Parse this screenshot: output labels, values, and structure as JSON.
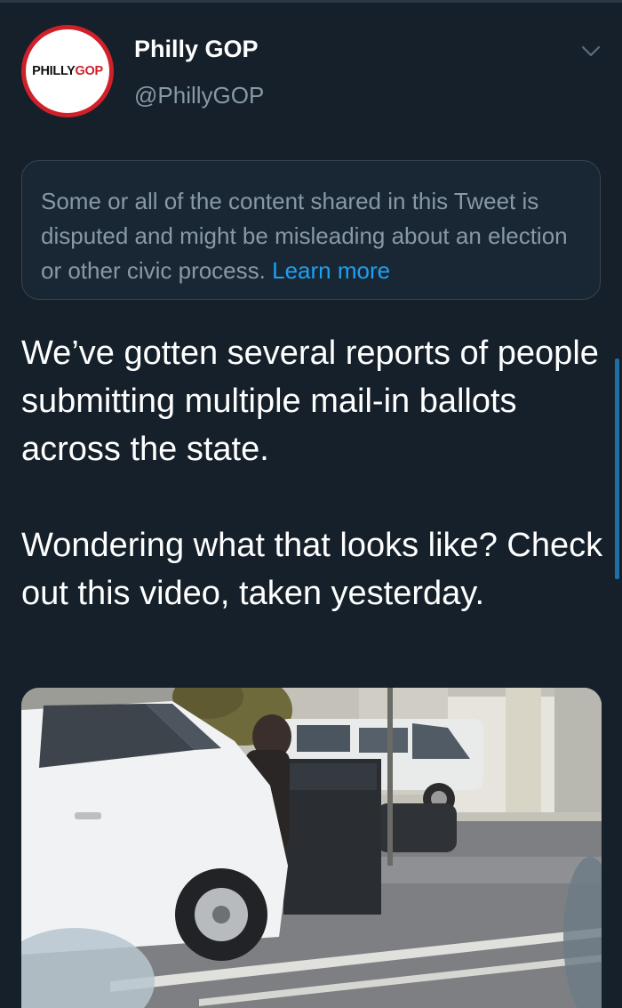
{
  "profile": {
    "display_name": "Philly GOP",
    "handle": "@PhillyGOP",
    "logo_text_1": "PHILLY",
    "logo_text_2": "GOP",
    "logo_color": "#d0202a"
  },
  "notice": {
    "text": "Some or all of the content shared in this Tweet is disputed and might be misleading about an election or other civic process.",
    "link_label": "Learn more"
  },
  "tweet": {
    "text": "We’ve gotten several reports of people submitting multiple mail-in ballots across the state.\n\nWondering what that looks like? Check out this video, taken yesterday."
  },
  "icons": {
    "menu": "chevron-down-icon"
  },
  "colors": {
    "background": "#15202b",
    "link": "#1da1f2",
    "secondary_text": "#8899a6"
  }
}
